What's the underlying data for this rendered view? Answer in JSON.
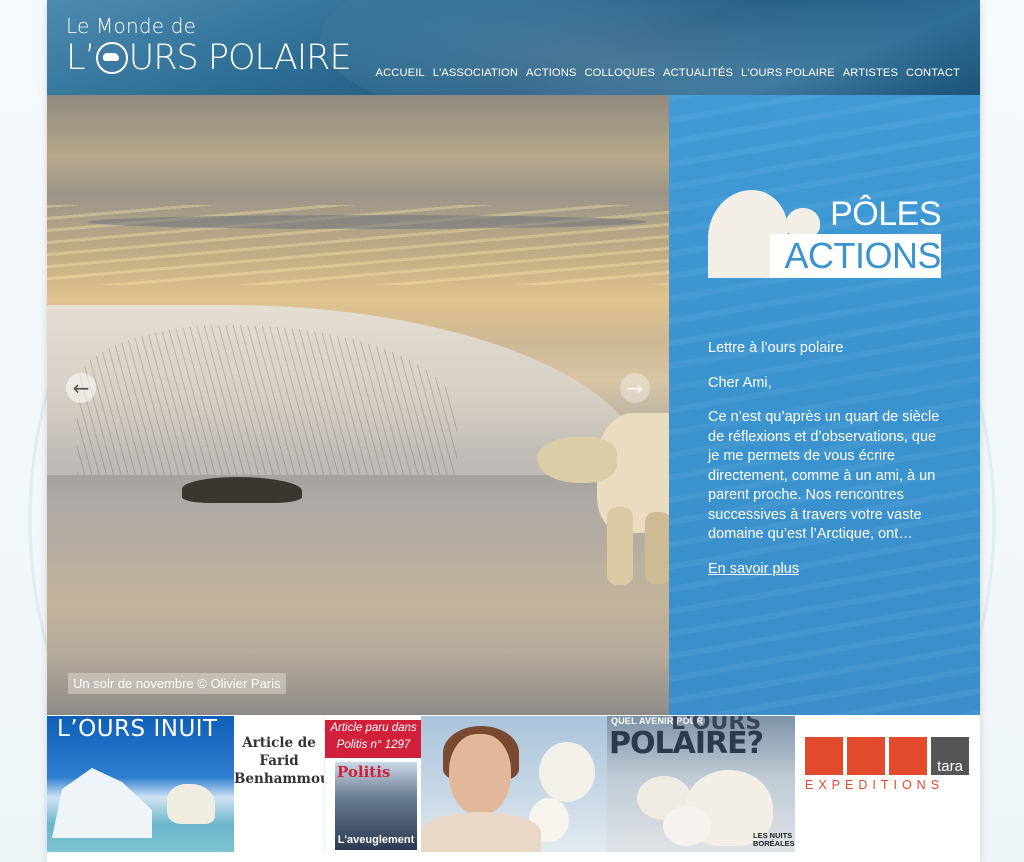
{
  "header": {
    "logo_line1": "Le Monde de",
    "logo_line2_a": "L’",
    "logo_line2_b": "URS POLAIRE"
  },
  "nav": {
    "items": [
      "ACCUEIL",
      "L'ASSOCIATION",
      "ACTIONS",
      "COLLOQUES",
      "ACTUALITÉS",
      "L'OURS POLAIRE",
      "ARTISTES",
      "CONTACT"
    ]
  },
  "hero": {
    "caption": "Un soir de novembre © Olivier Paris",
    "prev_icon": "arrow-left-icon",
    "next_icon": "arrow-right-icon"
  },
  "panel": {
    "logo_top": "PÔLES",
    "logo_bottom": "ACTIONS",
    "letter_title": "Lettre à l’ours polaire",
    "greeting": "Cher Ami,",
    "body": "Ce n’est qu’après un quart de siècle de réflexions et d’observations, que je me permets de vous écrire directement, comme à un ami, à un parent proche. Nos rencontres successives à travers votre vaste domaine qu’est l’Arctique, ont…",
    "more_link": "En savoir plus"
  },
  "tiles": {
    "t1_title": "L’OURS INUIT",
    "t2_text": "Article de Farid Benhammou",
    "t3_top": "Article paru dans Politis n° 1297",
    "t3_logo": "Politis",
    "t3_foot": "L'aveuglement",
    "t5_question": "QUEL AVENIR POUR",
    "t5_line1": "L'OURS",
    "t5_line2": "POLAIRE?",
    "t5_foot": "LES NUITS BORÉALES",
    "t6_tara": "tara",
    "t6_exp": "EXPEDITIONS"
  }
}
